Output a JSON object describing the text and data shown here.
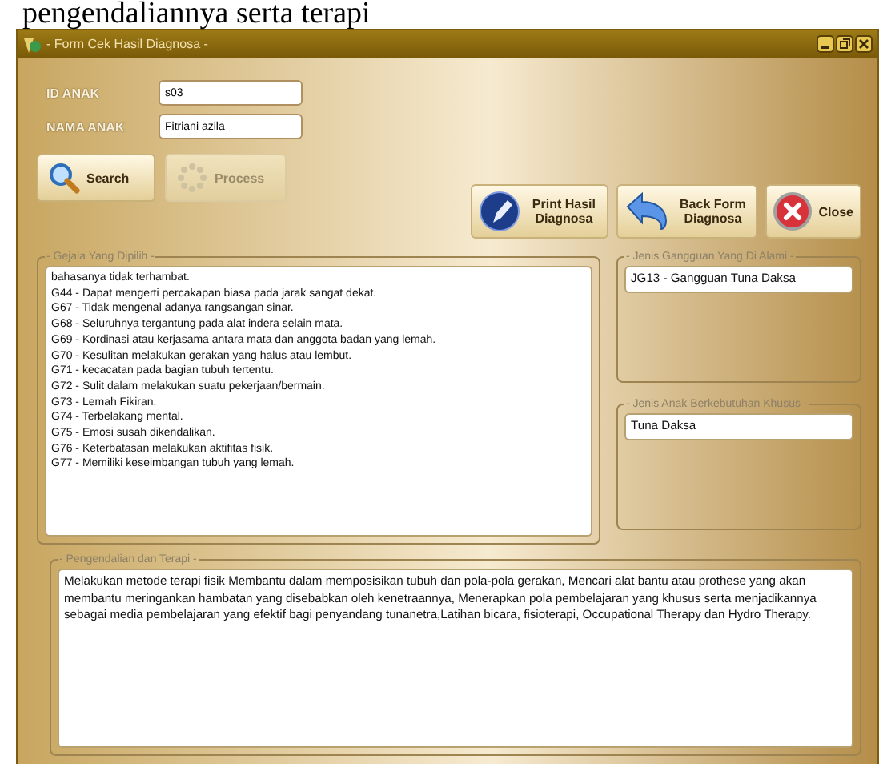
{
  "caption": "pengendaliannya serta terapi",
  "window": {
    "title": "- Form Cek Hasil Diagnosa -"
  },
  "fields": [
    {
      "label": "ID ANAK",
      "value": "s03"
    },
    {
      "label": "NAMA ANAK",
      "value": "Fitriani azila"
    }
  ],
  "buttons": [
    {
      "kind": "search",
      "label": "Search",
      "disabled": false
    },
    {
      "kind": "process",
      "label": "Process",
      "disabled": true
    }
  ],
  "actions": [
    {
      "kind": "print",
      "label": "Print Hasil Diagnosa"
    },
    {
      "kind": "back",
      "label": "Back Form Diagnosa"
    },
    {
      "kind": "close",
      "label": "Close"
    }
  ],
  "symptoms": {
    "legend": "- Gejala Yang Dipilih -",
    "lines": [
      "bahasanya tidak terhambat.",
      "G44 - Dapat mengerti percakapan biasa pada jarak sangat dekat.",
      "G67 - Tidak mengenal adanya rangsangan sinar.",
      "G68 - Seluruhnya tergantung pada alat indera selain mata.",
      "G69 - Kordinasi atau kerjasama antara mata dan anggota badan yang lemah.",
      "G70 - Kesulitan melakukan gerakan yang halus atau lembut.",
      "G71 - kecacatan pada bagian tubuh tertentu.",
      "G72 - Sulit dalam melakukan suatu pekerjaan/bermain.",
      "G73 - Lemah Fikiran.",
      "G74 - Terbelakang mental.",
      "G75 - Emosi susah dikendalikan.",
      "G76 - Keterbatasan melakukan aktifitas fisik.",
      "G77 - Memiliki keseimbangan tubuh yang lemah."
    ]
  },
  "disorder": {
    "legend": "- Jenis Gangguan Yang Di Alami -",
    "value": "JG13 - Gangguan Tuna Daksa"
  },
  "child_type": {
    "legend": "- Jenis Anak Berkebutuhan Khusus -",
    "value": "Tuna Daksa"
  },
  "therapy": {
    "legend": "- Pengendalian dan Terapi -",
    "value": "Melakukan metode terapi fisik Membantu dalam memposisikan tubuh dan pola-pola gerakan, Mencari alat bantu atau prothese yang akan membantu meringankan hambatan yang disebabkan oleh kenetraannya, Menerapkan pola pembelajaran yang khusus serta menjadikannya sebagai media pembelajaran yang efektif bagi penyandang tunanetra,Latihan bicara, fisioterapi, Occupational Therapy dan Hydro Therapy."
  }
}
